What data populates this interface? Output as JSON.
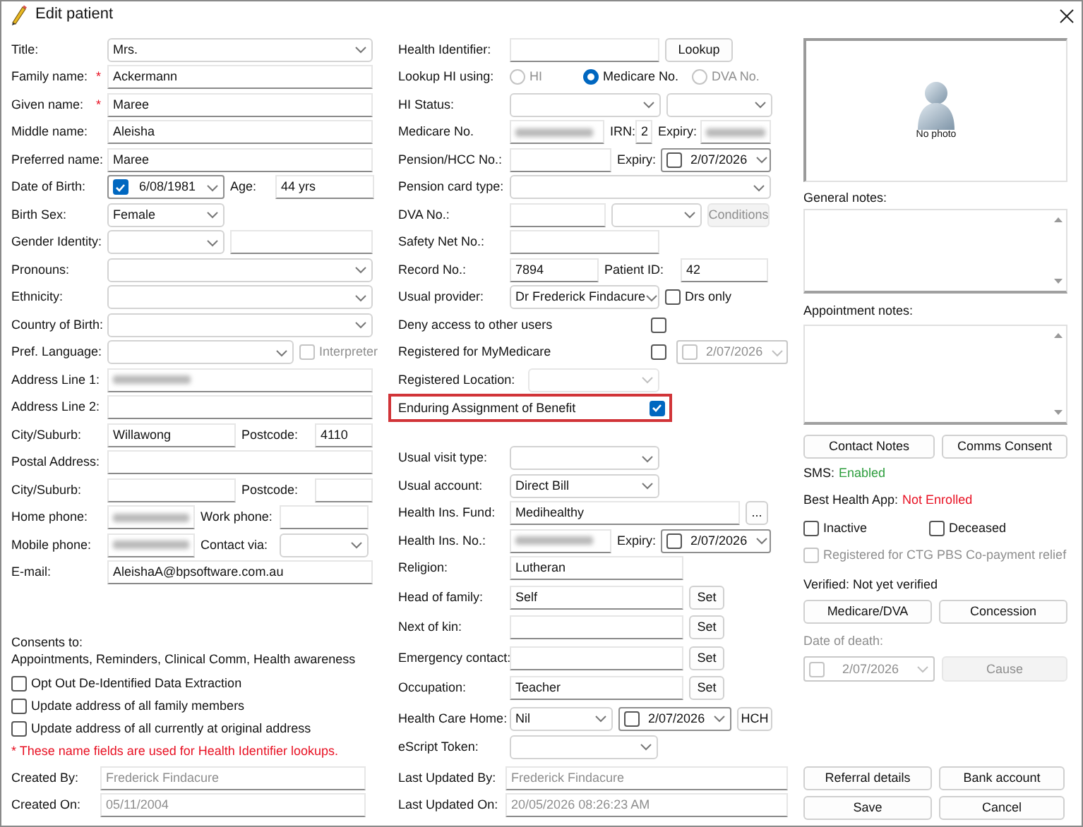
{
  "window": {
    "title": "Edit patient"
  },
  "patient_details": [
    [
      {
        "kind": "label",
        "text": "Title:"
      },
      {
        "kind": "select",
        "value": "Mrs."
      }
    ],
    [
      {
        "kind": "label",
        "text": "Family name:"
      },
      {
        "kind": "required",
        "text": "*"
      },
      {
        "kind": "text",
        "value": "Ackermann"
      }
    ],
    [
      {
        "kind": "label",
        "text": "Given name:"
      },
      {
        "kind": "required",
        "text": "*"
      },
      {
        "kind": "text",
        "value": "Maree"
      }
    ],
    [
      {
        "kind": "label",
        "text": "Middle name:"
      },
      {
        "kind": "text",
        "value": "Aleisha"
      }
    ],
    [
      {
        "kind": "label",
        "text": "Preferred name:"
      },
      {
        "kind": "text",
        "value": "Maree"
      }
    ],
    [
      {
        "kind": "label",
        "text": "Date of Birth:"
      },
      {
        "kind": "date",
        "checked": true,
        "value": "6/08/1981"
      },
      {
        "kind": "label",
        "text": "Age:"
      },
      {
        "kind": "text",
        "value": "44 yrs"
      }
    ],
    [
      {
        "kind": "label",
        "text": "Birth Sex:"
      },
      {
        "kind": "select",
        "value": "Female"
      }
    ],
    [
      {
        "kind": "label",
        "text": "Gender Identity:"
      },
      {
        "kind": "select"
      },
      {
        "kind": "text"
      }
    ],
    [
      {
        "kind": "label",
        "text": "Pronouns:"
      },
      {
        "kind": "select"
      }
    ],
    [
      {
        "kind": "label",
        "text": "Ethnicity:"
      },
      {
        "kind": "select"
      }
    ],
    [
      {
        "kind": "label",
        "text": "Country of Birth:"
      },
      {
        "kind": "select"
      }
    ],
    [
      {
        "kind": "label",
        "text": "Pref. Language:"
      },
      {
        "kind": "select"
      },
      {
        "kind": "check",
        "checked": false,
        "disabled": true,
        "label": "Interpreter"
      }
    ],
    [
      {
        "kind": "label",
        "text": "Address Line 1:"
      },
      {
        "kind": "text",
        "redacted": true
      }
    ],
    [
      {
        "kind": "label",
        "text": "Address Line 2:"
      },
      {
        "kind": "text"
      }
    ],
    [
      {
        "kind": "label",
        "text": "City/Suburb:"
      },
      {
        "kind": "text",
        "value": "Willawong"
      },
      {
        "kind": "label",
        "text": "Postcode:"
      },
      {
        "kind": "text",
        "value": "4110"
      }
    ],
    [
      {
        "kind": "label",
        "text": "Postal Address:"
      },
      {
        "kind": "text"
      }
    ],
    [
      {
        "kind": "label",
        "text": "City/Suburb:"
      },
      {
        "kind": "text"
      },
      {
        "kind": "label",
        "text": "Postcode:"
      },
      {
        "kind": "text"
      }
    ],
    [
      {
        "kind": "label",
        "text": "Home phone:"
      },
      {
        "kind": "text",
        "redacted": true
      },
      {
        "kind": "label",
        "text": "Work phone:"
      },
      {
        "kind": "text"
      }
    ],
    [
      {
        "kind": "label",
        "text": "Mobile phone:"
      },
      {
        "kind": "text",
        "redacted": true
      },
      {
        "kind": "label",
        "text": "Contact via:"
      },
      {
        "kind": "select"
      }
    ],
    [
      {
        "kind": "label",
        "text": "E-mail:"
      },
      {
        "kind": "text",
        "value": "AleishaA@bpsoftware.com.au"
      }
    ]
  ],
  "consents": {
    "heading": "Consents to:",
    "summary": "Appointments, Reminders, Clinical Comm, Health awareness"
  },
  "options": [
    {
      "label": "Opt Out De-Identified Data Extraction",
      "checked": false
    },
    {
      "label": "Update address of all family members",
      "checked": false
    },
    {
      "label": "Update address of all currently at original address",
      "checked": false
    }
  ],
  "note": "* These name fields are used for Health Identifier lookups.",
  "created": [
    [
      {
        "kind": "label",
        "text": "Created By:"
      },
      {
        "kind": "text",
        "value": "Frederick Findacure",
        "disabled": true
      }
    ],
    [
      {
        "kind": "label",
        "text": "Created On:"
      },
      {
        "kind": "text",
        "value": "05/11/2004",
        "disabled": true
      }
    ]
  ],
  "identifiers": [
    [
      {
        "kind": "label",
        "text": "Health Identifier:"
      },
      {
        "kind": "text"
      },
      {
        "kind": "button",
        "label": "Lookup"
      }
    ],
    [
      {
        "kind": "label",
        "text": "Lookup HI using:"
      },
      {
        "kind": "radio",
        "label": "HI",
        "selected": false,
        "disabled": true
      },
      {
        "kind": "radio",
        "label": "Medicare No.",
        "selected": true,
        "disabled": false
      },
      {
        "kind": "radio",
        "label": "DVA No.",
        "selected": false,
        "disabled": true
      }
    ],
    [
      {
        "kind": "label",
        "text": "HI Status:"
      },
      {
        "kind": "select"
      },
      {
        "kind": "select"
      }
    ],
    [
      {
        "kind": "label",
        "text": "Medicare No."
      },
      {
        "kind": "text",
        "redacted": true
      },
      {
        "kind": "label",
        "text": "IRN:"
      },
      {
        "kind": "text",
        "value": "2"
      },
      {
        "kind": "label",
        "text": "Expiry:"
      },
      {
        "kind": "text",
        "redacted": true
      }
    ],
    [
      {
        "kind": "label",
        "text": "Pension/HCC No.:"
      },
      {
        "kind": "text"
      },
      {
        "kind": "label",
        "text": "Expiry:"
      },
      {
        "kind": "date",
        "checked": false,
        "value": "2/07/2026"
      }
    ],
    [
      {
        "kind": "label",
        "text": "Pension card type:"
      },
      {
        "kind": "select"
      }
    ],
    [
      {
        "kind": "label",
        "text": "DVA No.:"
      },
      {
        "kind": "text"
      },
      {
        "kind": "select"
      },
      {
        "kind": "button",
        "label": "Conditions",
        "disabled": true
      }
    ],
    [
      {
        "kind": "label",
        "text": "Safety Net No.:"
      },
      {
        "kind": "text"
      }
    ],
    [
      {
        "kind": "label",
        "text": "Record No.:"
      },
      {
        "kind": "text",
        "value": "7894"
      },
      {
        "kind": "label",
        "text": "Patient ID:"
      },
      {
        "kind": "text",
        "value": "42"
      }
    ],
    [
      {
        "kind": "label",
        "text": "Usual provider:"
      },
      {
        "kind": "select",
        "value": "Dr Frederick Findacure"
      },
      {
        "kind": "check",
        "checked": false,
        "label": "Drs only"
      }
    ],
    [
      {
        "kind": "label",
        "text": "Deny access to other users"
      },
      {
        "kind": "check",
        "checked": false
      }
    ],
    [
      {
        "kind": "label",
        "text": "Registered for MyMedicare"
      },
      {
        "kind": "check",
        "checked": false
      },
      {
        "kind": "date",
        "checked": false,
        "value": "2/07/2026",
        "disabled": true
      }
    ],
    [
      {
        "kind": "label",
        "text": "Registered Location:"
      },
      {
        "kind": "select",
        "disabled": true
      }
    ]
  ],
  "eab": {
    "label": "Enduring Assignment of Benefit",
    "checked": true
  },
  "other_details": [
    [
      {
        "kind": "label",
        "text": "Usual visit type:"
      },
      {
        "kind": "select"
      }
    ],
    [
      {
        "kind": "label",
        "text": "Usual account:"
      },
      {
        "kind": "select",
        "value": "Direct Bill"
      }
    ],
    [
      {
        "kind": "label",
        "text": "Health Ins. Fund:"
      },
      {
        "kind": "text",
        "value": "Medihealthy"
      },
      {
        "kind": "button",
        "label": "..."
      }
    ],
    [
      {
        "kind": "label",
        "text": "Health Ins. No.:"
      },
      {
        "kind": "text",
        "redacted": true
      },
      {
        "kind": "label",
        "text": "Expiry:"
      },
      {
        "kind": "date",
        "checked": false,
        "value": "2/07/2026"
      }
    ],
    [
      {
        "kind": "label",
        "text": "Religion:"
      },
      {
        "kind": "text",
        "value": "Lutheran"
      }
    ],
    [
      {
        "kind": "label",
        "text": "Head of family:"
      },
      {
        "kind": "text",
        "value": "Self"
      },
      {
        "kind": "button",
        "label": "Set"
      }
    ],
    [
      {
        "kind": "label",
        "text": "Next of kin:"
      },
      {
        "kind": "text"
      },
      {
        "kind": "button",
        "label": "Set"
      }
    ],
    [
      {
        "kind": "label",
        "text": "Emergency contact:"
      },
      {
        "kind": "text"
      },
      {
        "kind": "button",
        "label": "Set"
      }
    ],
    [
      {
        "kind": "label",
        "text": "Occupation:"
      },
      {
        "kind": "text",
        "value": "Teacher"
      },
      {
        "kind": "button",
        "label": "Set"
      }
    ],
    [
      {
        "kind": "label",
        "text": "Health Care Home:"
      },
      {
        "kind": "select",
        "value": "Nil"
      },
      {
        "kind": "date",
        "checked": false,
        "value": "2/07/2026"
      },
      {
        "kind": "button",
        "label": "HCH"
      }
    ],
    [
      {
        "kind": "label",
        "text": "eScript Token:"
      },
      {
        "kind": "select"
      }
    ]
  ],
  "updated": [
    [
      {
        "kind": "label",
        "text": "Last Updated By:"
      },
      {
        "kind": "text",
        "value": "Frederick Findacure",
        "disabled": true
      }
    ],
    [
      {
        "kind": "label",
        "text": "Last Updated On:"
      },
      {
        "kind": "text",
        "value": "20/05/2026 08:26:23 AM",
        "disabled": true
      }
    ]
  ],
  "photo": {
    "caption": "No photo"
  },
  "general_notes": {
    "label": "General notes:"
  },
  "appointment_notes": {
    "label": "Appointment notes:"
  },
  "contact_buttons": [
    {
      "label": "Contact Notes"
    },
    {
      "label": "Comms Consent"
    }
  ],
  "sms": {
    "label": "SMS:",
    "value": "Enabled",
    "color": "#2e9e3e"
  },
  "best_health_app": {
    "label": "Best Health App:",
    "value": "Not Enrolled",
    "color": "#e81123"
  },
  "status_checks": [
    {
      "label": "Inactive",
      "checked": false
    },
    {
      "label": "Deceased",
      "checked": false
    }
  ],
  "ctg": {
    "label": "Registered for CTG PBS Co-payment relief",
    "checked": false,
    "disabled": true
  },
  "verified": "Verified: Not yet verified",
  "verify_buttons": [
    {
      "label": "Medicare/DVA"
    },
    {
      "label": "Concession"
    }
  ],
  "date_of_death": {
    "label": "Date of death:",
    "checked": false,
    "value": "2/07/2026",
    "disabled": true
  },
  "cause_button": {
    "label": "Cause",
    "disabled": true
  },
  "bottom_buttons": [
    {
      "label": "Referral details"
    },
    {
      "label": "Bank account"
    },
    {
      "label": "Save"
    },
    {
      "label": "Cancel"
    }
  ]
}
